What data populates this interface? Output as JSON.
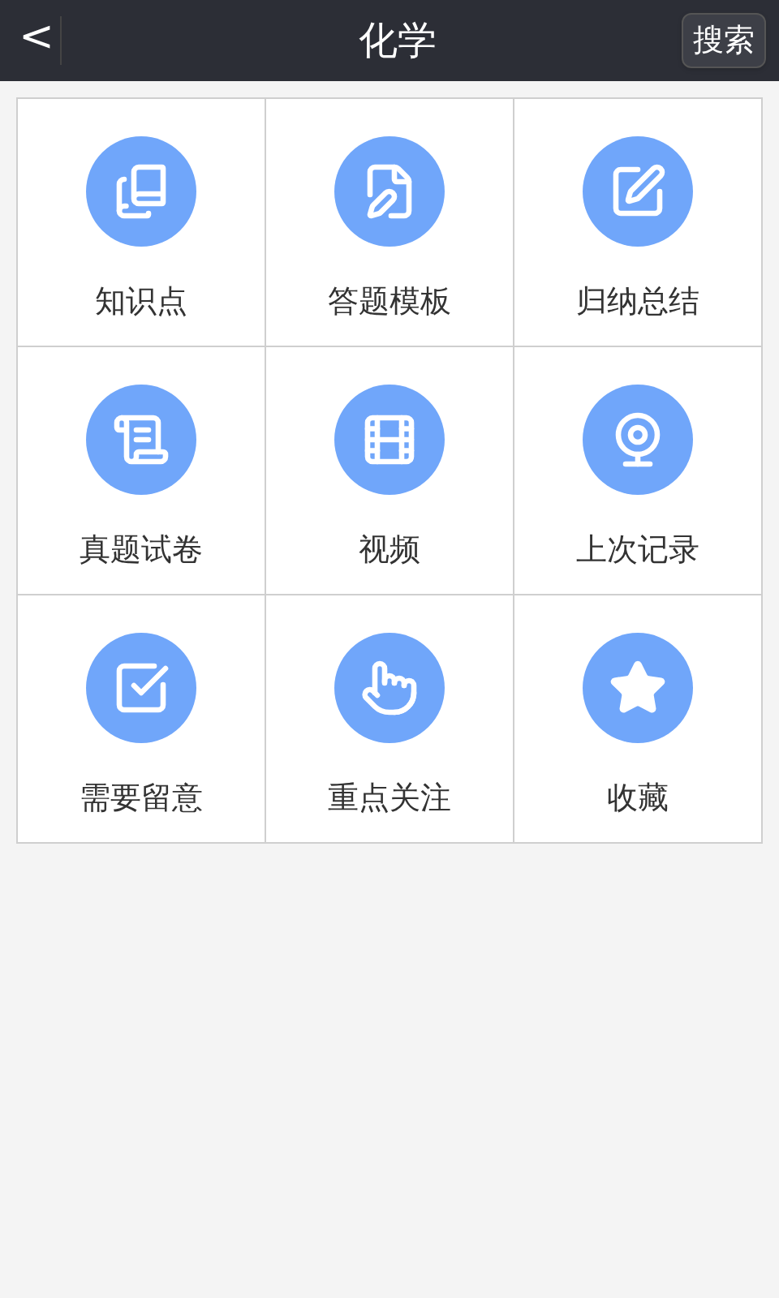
{
  "header": {
    "back": "<",
    "title": "化学",
    "search_button": "搜索"
  },
  "tiles": [
    {
      "label": "知识点",
      "kind": "books"
    },
    {
      "label": "答题模板",
      "kind": "document"
    },
    {
      "label": "归纳总结",
      "kind": "edit"
    },
    {
      "label": "真题试卷",
      "kind": "scroll"
    },
    {
      "label": "视频",
      "kind": "film"
    },
    {
      "label": "上次记录",
      "kind": "webcam"
    },
    {
      "label": "需要留意",
      "kind": "check"
    },
    {
      "label": "重点关注",
      "kind": "hand"
    },
    {
      "label": "收藏",
      "kind": "star"
    }
  ]
}
